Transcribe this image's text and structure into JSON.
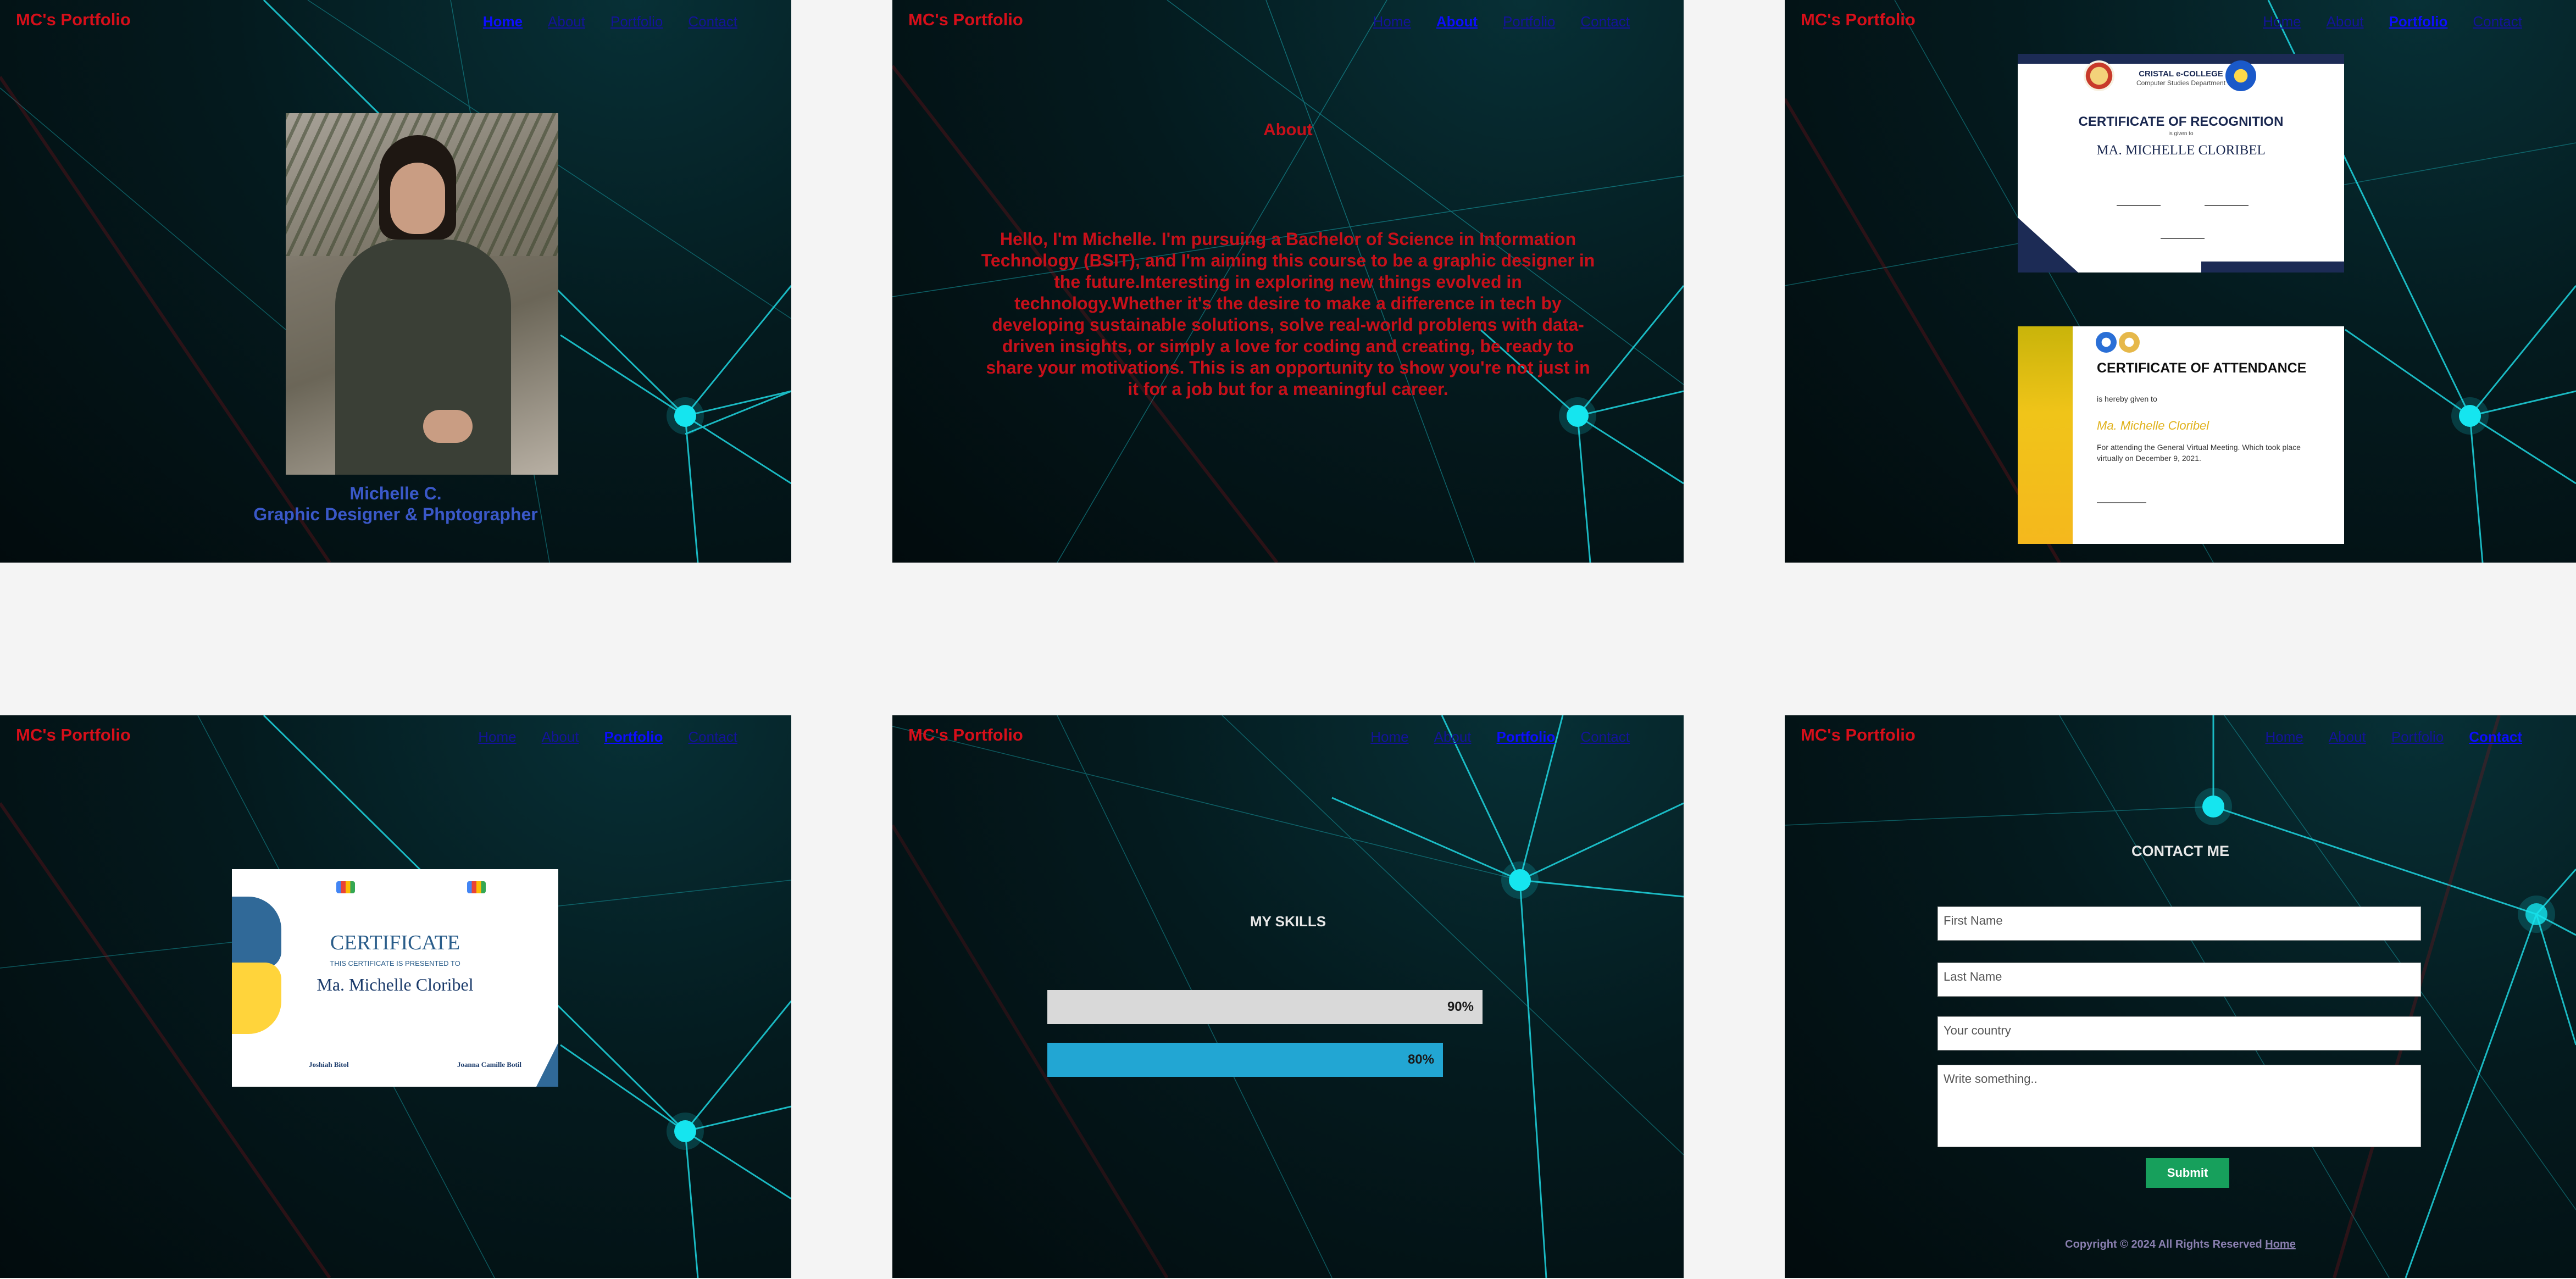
{
  "site": {
    "logo": "MC's Portfolio"
  },
  "nav": {
    "home": "Home",
    "about": "About",
    "portfolio": "Portfolio",
    "contact": "Contact"
  },
  "colors": {
    "logo": "#d60f1a",
    "accent_line": "#1fd6e0",
    "node": "#15e6ef",
    "skill_bar_2": "#22a6d3",
    "skill_bar_1": "#d9d9d9",
    "submit": "#17a05c"
  },
  "home": {
    "photo_icon": "portrait-photo",
    "name": "Michelle C.",
    "role": "Graphic Designer & Phptographer"
  },
  "about": {
    "title": "About",
    "text": "Hello, I'm Michelle. I'm pursuing a Bachelor of Science in Information Technology (BSIT), and I'm aiming this course to be a graphic designer in the future.Interesting in exploring new things evolved in technology.Whether it's the desire to make a difference in tech by developing sustainable solutions, solve real-world problems with data-driven insights, or simply a love for coding and creating, be ready to share your motivations. This is an opportunity to show you're not just in it for a job but for a meaningful career."
  },
  "portfolio": {
    "cert1": {
      "school": "CRISTAL e-COLLEGE",
      "dept": "Computer Studies Department",
      "title": "CERTIFICATE OF RECOGNITION",
      "given": "is given to",
      "name": "MA. MICHELLE CLORIBEL"
    },
    "cert2": {
      "title": "CERTIFICATE OF ATTENDANCE",
      "given": "is hereby given to",
      "name": "Ma. Michelle Cloribel",
      "body": "For attending the General Virtual Meeting. Which took place virtually on December 9, 2021."
    },
    "cert3": {
      "title": "CERTIFICATE",
      "subtitle": "THIS CERTIFICATE IS PRESENTED TO",
      "name": "Ma. Michelle Cloribel",
      "sig1": "Joshiah Bitol",
      "sig2": "Joanna Camille Botil"
    }
  },
  "skills": {
    "title": "MY SKILLS",
    "items": [
      {
        "label": "90%",
        "value": 0.9
      },
      {
        "label": "80%",
        "value": 0.8
      }
    ]
  },
  "contact": {
    "title": "CONTACT ME",
    "first_name": "First Name",
    "last_name": "Last Name",
    "country": "Your country",
    "message": "Write something..",
    "submit": "Submit",
    "footer_text": "Copyright © 2024 All Rights Reserved",
    "footer_link": "Home"
  }
}
